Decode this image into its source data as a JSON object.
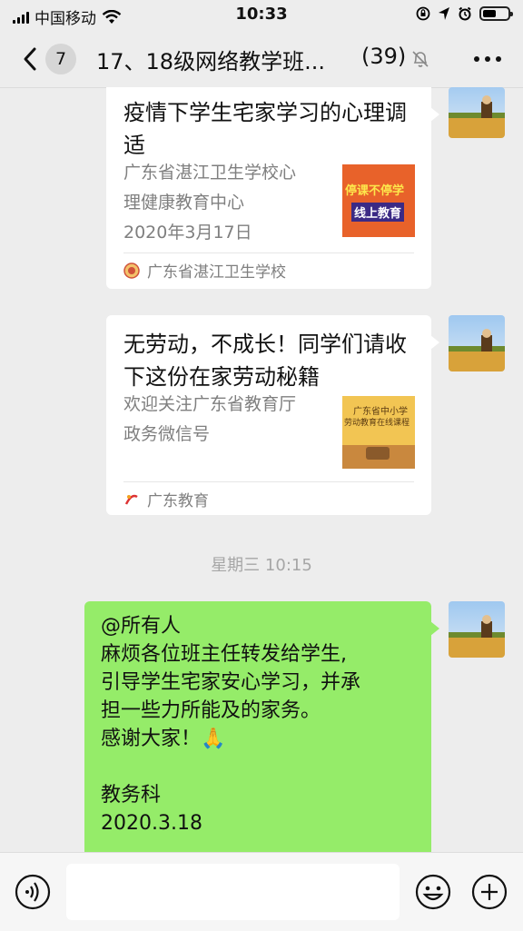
{
  "status_bar": {
    "carrier": "中国移动",
    "time": "10:33",
    "battery_level": 0.55
  },
  "nav": {
    "unread_count": "7",
    "title": "17、18级网络教学班...",
    "member_count": "(39)",
    "icons": [
      "back-chevron-icon",
      "mute-bell-icon",
      "more-icon"
    ]
  },
  "messages": {
    "card1": {
      "title": "疫情下学生宅家学习的心理调适",
      "desc": [
        "广东省湛江卫生学校心",
        "理健康教育中心",
        "2020年3月17日"
      ],
      "thumb_text": [
        "停课不停学",
        "线上教育"
      ],
      "source": "广东省湛江卫生学校"
    },
    "card2": {
      "title": "无劳动，不成长！同学们请收下这份在家劳动秘籍",
      "desc": [
        "欢迎关注广东省教育厅",
        "政务微信号"
      ],
      "thumb_text": [
        "广东省中小学",
        "劳动教育在线课程"
      ],
      "source": "广东教育"
    },
    "timestamp": "星期三 10:15",
    "bubble": {
      "lines": [
        "@所有人",
        "麻烦各位班主任转发给学生,",
        "引导学生宅家安心学习，并承",
        "担一些力所能及的家务。",
        "感谢大家！🙏",
        "",
        "教务科",
        "2020.3.18"
      ]
    }
  },
  "input_bar": {
    "placeholder": "",
    "icons": [
      "voice-icon",
      "emoji-icon",
      "plus-icon"
    ]
  },
  "colors": {
    "background": "#ededed",
    "bubble_green": "#95ec69",
    "card_white": "#ffffff",
    "secondary_text": "#7f7f7f"
  }
}
